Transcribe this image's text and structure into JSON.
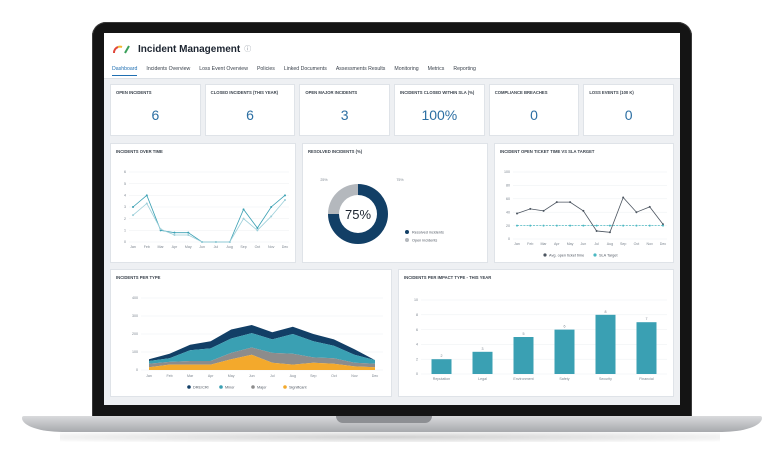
{
  "app": {
    "title": "Incident Management",
    "info_glyph": "ⓘ"
  },
  "tabs": [
    "Dashboard",
    "Incidents Overview",
    "Loss Event Overview",
    "Policies",
    "Linked Documents",
    "Assessments Results",
    "Monitoring",
    "Metrics",
    "Reporting"
  ],
  "kpis": [
    {
      "label": "Open Incidents",
      "value": "6"
    },
    {
      "label": "Closed Incidents (this year)",
      "value": "6"
    },
    {
      "label": "Open Major Incidents",
      "value": "3"
    },
    {
      "label": "Incidents Closed within SLA (%)",
      "value": "100%"
    },
    {
      "label": "Compliance Breaches",
      "value": "0"
    },
    {
      "label": "Loss Events (100 K)",
      "value": "0"
    }
  ],
  "colors": {
    "accent": "#1f6fb2",
    "teal": "#3aa0b3",
    "navy": "#123f66",
    "gray": "#8c8c8c",
    "orange": "#f3a92c"
  },
  "charts": [
    {
      "title": "Incidents over time",
      "type": "line",
      "months": [
        "Jan",
        "Feb",
        "Mar",
        "Apr",
        "May",
        "Jun",
        "Jul",
        "Aug",
        "Sep",
        "Oct",
        "Nov",
        "Dec"
      ],
      "y_ticks": [
        "0",
        "1",
        "2",
        "3",
        "4",
        "5",
        "6"
      ],
      "ylim": [
        0,
        6
      ],
      "series": [
        {
          "values": [
            3,
            4,
            1,
            0.8,
            0.8,
            0,
            0,
            0,
            2.8,
            1.2,
            3,
            4
          ]
        },
        {
          "values": [
            2.3,
            3.3,
            1.1,
            0.6,
            0.6,
            0,
            0,
            0,
            2,
            1,
            2.2,
            3.6
          ]
        }
      ]
    },
    {
      "title": "Resolved Incidents (%)",
      "type": "pie",
      "center_label": "75%",
      "slices": [
        {
          "name": "Resolved incidents",
          "value": 75,
          "label": "75%"
        },
        {
          "name": "Open incidents",
          "value": 25,
          "label": "25%"
        }
      ]
    },
    {
      "title": "Incident Open Ticket Time vs SLA Target",
      "type": "line",
      "months": [
        "Jan",
        "Feb",
        "Mar",
        "Apr",
        "May",
        "Jun",
        "Jul",
        "Aug",
        "Sep",
        "Oct",
        "Nov",
        "Dec"
      ],
      "y_ticks": [
        "0",
        "20",
        "40",
        "60",
        "80",
        "100"
      ],
      "ylim": [
        0,
        100
      ],
      "series": [
        {
          "name": "Avg. open ticket time",
          "values": [
            38,
            45,
            42,
            55,
            55,
            42,
            12,
            10,
            62,
            40,
            48,
            22
          ]
        },
        {
          "name": "SLA Target",
          "values": [
            20,
            20,
            20,
            20,
            20,
            20,
            20,
            20,
            20,
            20,
            20,
            20
          ]
        }
      ]
    },
    {
      "title": "Incidents per type",
      "type": "area",
      "months": [
        "Jan",
        "Feb",
        "Mar",
        "Apr",
        "May",
        "Jun",
        "Jul",
        "Aug",
        "Sep",
        "Oct",
        "Nov",
        "Dec"
      ],
      "y_ticks": [
        "0",
        "100",
        "200",
        "300",
        "400"
      ],
      "ylim": [
        0,
        400
      ],
      "series": [
        {
          "name": "Significant",
          "values": [
            15,
            30,
            30,
            30,
            60,
            85,
            40,
            30,
            40,
            35,
            20,
            15
          ]
        },
        {
          "name": "Major",
          "values": [
            20,
            15,
            20,
            20,
            35,
            40,
            55,
            60,
            30,
            30,
            20,
            20
          ]
        },
        {
          "name": "Minor",
          "values": [
            15,
            20,
            60,
            70,
            80,
            80,
            75,
            110,
            90,
            70,
            45,
            20
          ]
        },
        {
          "name": "DRE/CRI",
          "values": [
            10,
            25,
            30,
            40,
            50,
            45,
            40,
            40,
            40,
            35,
            30,
            0
          ]
        }
      ]
    },
    {
      "title": "Incidents per impact type - this year",
      "type": "bar",
      "categories": [
        "Reputation",
        "Legal",
        "Environment",
        "Safety",
        "Security",
        "Financial"
      ],
      "values": [
        2,
        3,
        5,
        6,
        8,
        7
      ],
      "y_ticks": [
        "0",
        "2",
        "4",
        "6",
        "8",
        "10"
      ],
      "ylim": [
        0,
        10
      ]
    }
  ]
}
